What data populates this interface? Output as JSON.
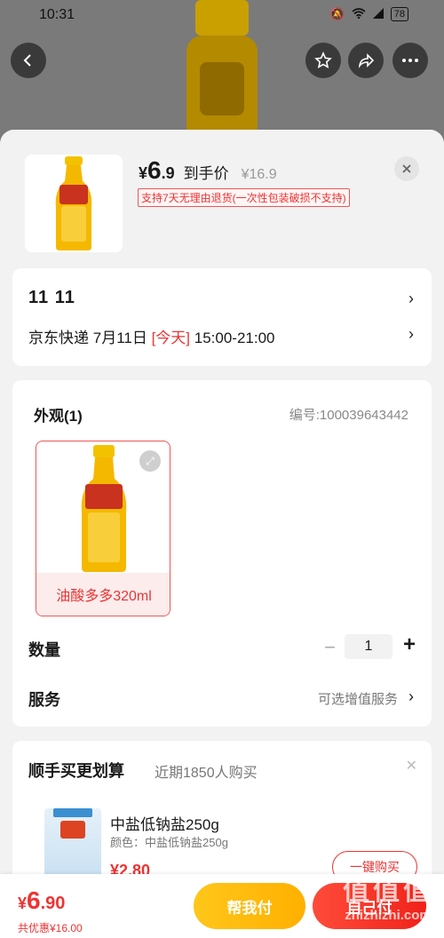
{
  "status_bar": {
    "time": "10:31",
    "battery": "78"
  },
  "sheet": {
    "price_symbol": "¥",
    "price_int": "6",
    "price_dec": ".9",
    "price_label": "到手价",
    "original_price": "¥16.9",
    "return_policy": "支持7天无理由退货(一次性包装破损不支持)"
  },
  "delivery": {
    "address": "11  11",
    "carrier": "京东快递",
    "date": "7月11日",
    "today": "[今天]",
    "window": "15:00-21:00"
  },
  "options": {
    "appearance_title": "外观(1)",
    "sku": "编号:100039643442",
    "variant_label": "油酸多多320ml",
    "quantity_label": "数量",
    "quantity_value": "1",
    "service_label": "服务",
    "service_value": "可选增值服务"
  },
  "bundle": {
    "title": "顺手买更划算",
    "subtitle": "近期1850人购买",
    "item_name": "中盐低钠盐250g",
    "item_color": "颜色：中盐低钠盐250g",
    "item_price": "¥2.80",
    "buy_label": "一键购买"
  },
  "bottom": {
    "total_symbol": "¥",
    "total_int": "6",
    "total_dec": ".90",
    "saved": "共优惠¥16.00",
    "help_pay": "帮我付",
    "self_pay": "自己付"
  },
  "watermark": {
    "main": "值值值",
    "url": "zhizhizhi.com"
  },
  "colors": {
    "accent_red": "#e33333",
    "accent_yellow": "#ffc61a"
  },
  "icons": [
    "back-icon",
    "star-icon",
    "share-icon",
    "more-icon",
    "close-icon",
    "chevron-right-icon",
    "expand-icon",
    "minus-icon",
    "plus-icon"
  ]
}
